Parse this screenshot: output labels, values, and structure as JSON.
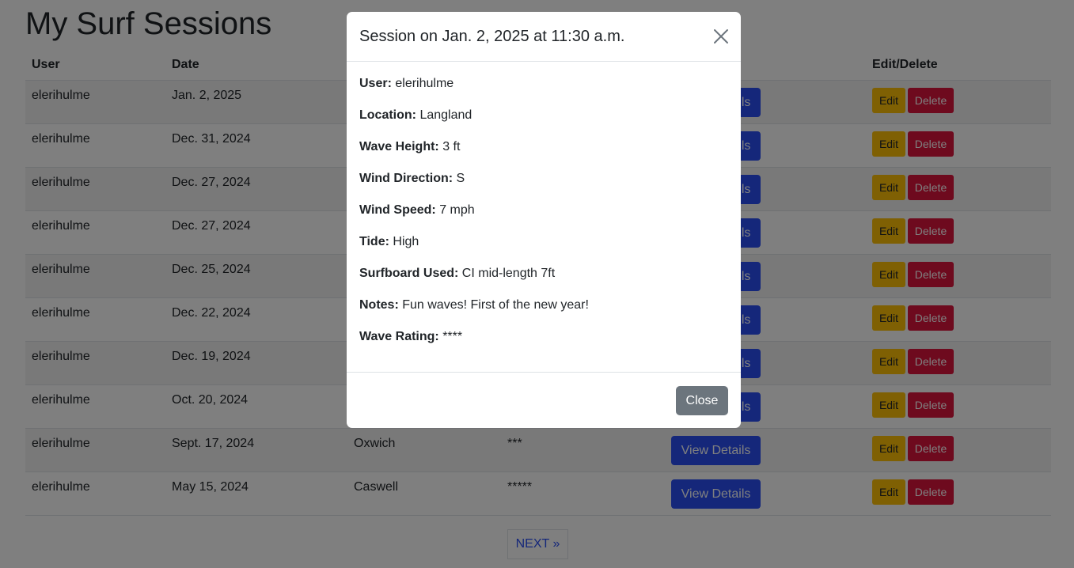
{
  "page": {
    "title": "My Surf Sessions"
  },
  "table": {
    "headers": {
      "user": "User",
      "date": "Date",
      "edit_delete": "Edit/Delete"
    },
    "view_label": "View Details",
    "edit_label": "Edit",
    "delete_label": "Delete",
    "rows": [
      {
        "user": "elerihulme",
        "date": "Jan. 2, 2025",
        "location": "",
        "rating": ""
      },
      {
        "user": "elerihulme",
        "date": "Dec. 31, 2024",
        "location": "",
        "rating": ""
      },
      {
        "user": "elerihulme",
        "date": "Dec. 27, 2024",
        "location": "",
        "rating": ""
      },
      {
        "user": "elerihulme",
        "date": "Dec. 27, 2024",
        "location": "",
        "rating": ""
      },
      {
        "user": "elerihulme",
        "date": "Dec. 25, 2024",
        "location": "",
        "rating": ""
      },
      {
        "user": "elerihulme",
        "date": "Dec. 22, 2024",
        "location": "",
        "rating": ""
      },
      {
        "user": "elerihulme",
        "date": "Dec. 19, 2024",
        "location": "",
        "rating": ""
      },
      {
        "user": "elerihulme",
        "date": "Oct. 20, 2024",
        "location": "",
        "rating": ""
      },
      {
        "user": "elerihulme",
        "date": "Sept. 17, 2024",
        "location": "Oxwich",
        "rating": "***"
      },
      {
        "user": "elerihulme",
        "date": "May 15, 2024",
        "location": "Caswell",
        "rating": "*****"
      }
    ]
  },
  "pagination": {
    "next_label": "NEXT »"
  },
  "modal": {
    "title": "Session on Jan. 2, 2025 at 11:30 a.m.",
    "fields": [
      {
        "label": "User:",
        "value": "elerihulme"
      },
      {
        "label": "Location:",
        "value": "Langland"
      },
      {
        "label": "Wave Height:",
        "value": "3 ft"
      },
      {
        "label": "Wind Direction:",
        "value": "S"
      },
      {
        "label": "Wind Speed:",
        "value": "7 mph"
      },
      {
        "label": "Tide:",
        "value": "High"
      },
      {
        "label": "Surfboard Used:",
        "value": "CI mid-length 7ft"
      },
      {
        "label": "Notes:",
        "value": "Fun waves! First of the new year!"
      },
      {
        "label": "Wave Rating:",
        "value": "****"
      }
    ],
    "close_label": "Close",
    "close_icon": "close-x-icon"
  },
  "colors": {
    "primary": "#2a4ff5",
    "warning": "#ffc107",
    "danger": "#dc143c",
    "secondary": "#6c757d"
  }
}
